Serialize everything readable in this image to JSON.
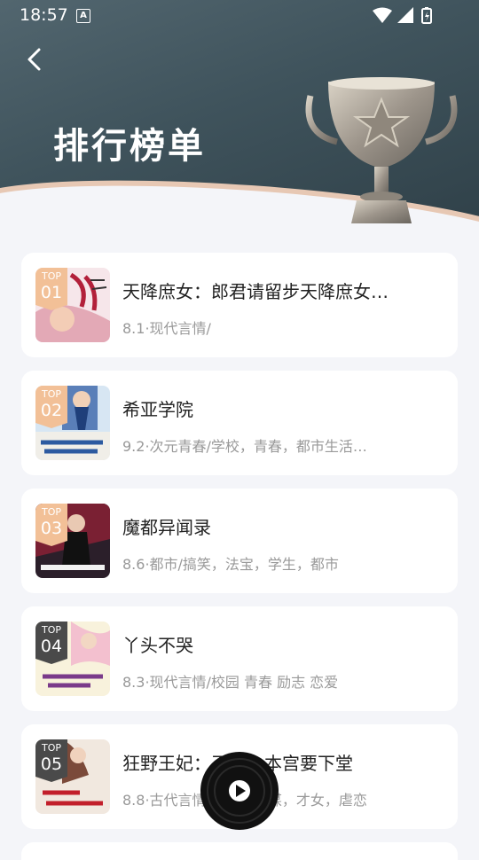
{
  "status_bar": {
    "time": "18:57",
    "a_icon": "A"
  },
  "header": {
    "title": "排行榜单",
    "back_icon": "chevron-left-icon",
    "trophy_icon": "trophy-icon"
  },
  "colors": {
    "header_bg": "#415560",
    "badge_gold": "#f2c097",
    "badge_dark": "#4a4a4a",
    "card_bg": "#ffffff",
    "page_bg": "#f4f5f9"
  },
  "books": [
    {
      "rank_label": "TOP",
      "rank": "01",
      "title": "天降庶女：郎君请留步天降庶女…",
      "meta": "8.1·现代言情/",
      "badge": "gold"
    },
    {
      "rank_label": "TOP",
      "rank": "02",
      "title": "希亚学院",
      "meta": "9.2·次元青春/学校，青春，都市生活…",
      "badge": "gold"
    },
    {
      "rank_label": "TOP",
      "rank": "03",
      "title": "魔都异闻录",
      "meta": "8.6·都市/搞笑，法宝，学生，都市",
      "badge": "gold"
    },
    {
      "rank_label": "TOP",
      "rank": "04",
      "title": "丫头不哭",
      "meta": "8.3·现代言情/校园 青春 励志 恋爱",
      "badge": "dark"
    },
    {
      "rank_label": "TOP",
      "rank": "05",
      "title": "狂野王妃：王爷，本宫要下堂",
      "meta": "8.8·古代言情/宫斗，权谋，才女，虐恋",
      "badge": "dark"
    }
  ],
  "floating_player": {
    "icon": "play-icon"
  }
}
